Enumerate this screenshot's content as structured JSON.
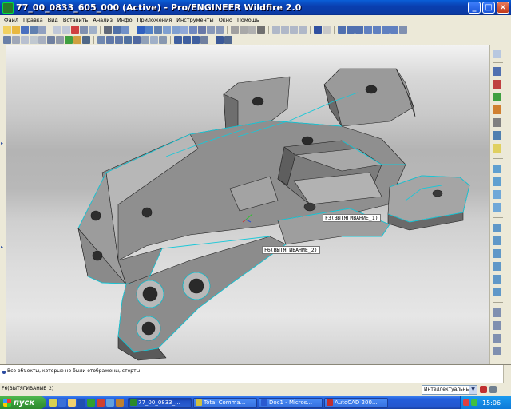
{
  "window": {
    "title": "77_00_0833_605_000 (Active) - Pro/ENGINEER Wildfire 2.0",
    "minimize": "_",
    "maximize": "□",
    "close": "×"
  },
  "menu": [
    "Файл",
    "Правка",
    "Вид",
    "Вставить",
    "Анализ",
    "Инфо",
    "Приложения",
    "Инструменты",
    "Окно",
    "Помощь"
  ],
  "viewport": {
    "feature_labels": [
      "F3(ВЫТЯГИВАНИЕ_1)",
      "F6(ВЫТЯГИВАНИЕ_2)"
    ],
    "colors": {
      "model": "#8c8c8c",
      "edges": "#18c8d8",
      "background_top": "#f3f3f3"
    }
  },
  "message": {
    "text": "Все объекты, которые не были отображены, стерты."
  },
  "status": {
    "selection": "F6(ВЫТЯГИВАНИЕ_2)",
    "filter": "Интеллектуальный",
    "filter_arrow": "▼"
  },
  "taskbar": {
    "start": "пуск",
    "tasks": [
      "77_00_0833_...",
      "Total Comma...",
      "Doc1 - Micros...",
      "AutoCAD 200..."
    ],
    "clock": "15:06"
  }
}
